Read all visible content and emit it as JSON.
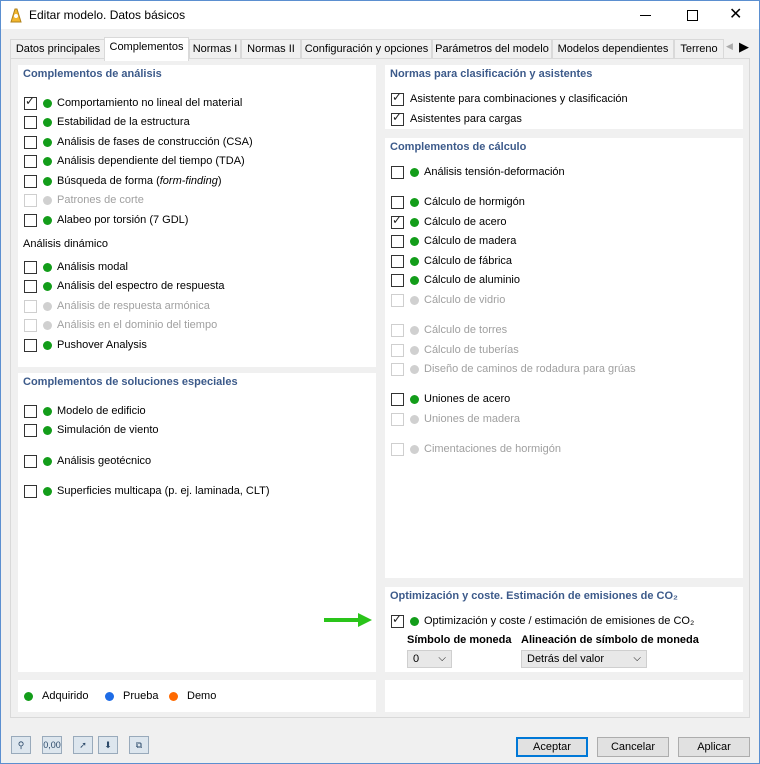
{
  "window": {
    "title": "Editar modelo. Datos básicos"
  },
  "tabs": [
    {
      "label": "Datos principales",
      "active": false
    },
    {
      "label": "Complementos",
      "active": true
    },
    {
      "label": "Normas I",
      "active": false
    },
    {
      "label": "Normas II",
      "active": false
    },
    {
      "label": "Configuración y opciones",
      "active": false
    },
    {
      "label": "Parámetros del modelo",
      "active": false
    },
    {
      "label": "Modelos dependientes",
      "active": false
    },
    {
      "label": "Terreno",
      "active": false
    }
  ],
  "analysis": {
    "title": "Complementos de análisis",
    "items": [
      {
        "label": "Comportamiento no lineal del material",
        "checked": true,
        "enabled": true
      },
      {
        "label": "Estabilidad de la estructura",
        "checked": false,
        "enabled": true
      },
      {
        "label": "Análisis de fases de construcción (CSA)",
        "checked": false,
        "enabled": true
      },
      {
        "label": "Análisis dependiente del tiempo (TDA)",
        "checked": false,
        "enabled": true
      },
      {
        "label_pre": "Búsqueda de forma (",
        "label_em": "form-finding",
        "label_post": ")",
        "checked": false,
        "enabled": true
      },
      {
        "label": "Patrones de corte",
        "checked": false,
        "enabled": false
      },
      {
        "label": "Alabeo por torsión (7 GDL)",
        "checked": false,
        "enabled": true
      }
    ],
    "dynamic_title": "Análisis dinámico",
    "dynamic_items": [
      {
        "label": "Análisis modal",
        "checked": false,
        "enabled": true
      },
      {
        "label": "Análisis del espectro de respuesta",
        "checked": false,
        "enabled": true
      },
      {
        "label": "Análisis de respuesta armónica",
        "checked": false,
        "enabled": false
      },
      {
        "label": "Análisis en el dominio del tiempo",
        "checked": false,
        "enabled": false
      },
      {
        "label": "Pushover Analysis",
        "checked": false,
        "enabled": true
      }
    ]
  },
  "special": {
    "title": "Complementos de soluciones especiales",
    "items": [
      {
        "label": "Modelo de edificio",
        "checked": false,
        "enabled": true
      },
      {
        "label": "Simulación de viento",
        "checked": false,
        "enabled": true
      },
      {
        "label": "Análisis geotécnico",
        "checked": false,
        "enabled": true
      },
      {
        "label": "Superficies multicapa (p. ej. laminada, CLT)",
        "checked": false,
        "enabled": true
      }
    ]
  },
  "norms": {
    "title": "Normas para clasificación y asistentes",
    "items": [
      {
        "label": "Asistente para combinaciones y clasificación",
        "checked": true
      },
      {
        "label": "Asistentes para cargas",
        "checked": true
      }
    ]
  },
  "calc": {
    "title": "Complementos de cálculo",
    "items": [
      {
        "label": "Análisis tensión-deformación",
        "checked": false,
        "enabled": true
      },
      {
        "label": "Cálculo de hormigón",
        "checked": false,
        "enabled": true
      },
      {
        "label": "Cálculo de acero",
        "checked": true,
        "enabled": true
      },
      {
        "label": "Cálculo de madera",
        "checked": false,
        "enabled": true
      },
      {
        "label": "Cálculo de fábrica",
        "checked": false,
        "enabled": true
      },
      {
        "label": "Cálculo de aluminio",
        "checked": false,
        "enabled": true
      },
      {
        "label": "Cálculo de vidrio",
        "checked": false,
        "enabled": false
      },
      {
        "label": "Cálculo de torres",
        "checked": false,
        "enabled": false
      },
      {
        "label": "Cálculo de tuberías",
        "checked": false,
        "enabled": false
      },
      {
        "label": "Diseño de caminos de rodadura para grúas",
        "checked": false,
        "enabled": false
      },
      {
        "label": "Uniones de acero",
        "checked": false,
        "enabled": true
      },
      {
        "label": "Uniones de madera",
        "checked": false,
        "enabled": false
      },
      {
        "label": "Cimentaciones de hormigón",
        "checked": false,
        "enabled": false
      }
    ]
  },
  "opt": {
    "title": "Optimización y coste. Estimación de emisiones de CO₂",
    "item_label": "Optimización y coste / estimación de emisiones de CO₂",
    "item_checked": true,
    "currency_label": "Símbolo de moneda",
    "currency_value": "0",
    "align_label": "Alineación de símbolo de moneda",
    "align_value": "Detrás del valor"
  },
  "legend": [
    {
      "label": "Adquirido",
      "color": "#139d1a"
    },
    {
      "label": "Prueba",
      "color": "#1e6ce6"
    },
    {
      "label": "Demo",
      "color": "#ff6a00"
    }
  ],
  "bottom_icons": [
    {
      "name": "search-icon",
      "glyph": "⚲"
    },
    {
      "name": "decimal-format-icon",
      "glyph": "0,00"
    },
    {
      "name": "model-info-icon",
      "glyph": "➚"
    },
    {
      "name": "import-icon",
      "glyph": "⬇"
    },
    {
      "name": "copy-icon",
      "glyph": "⧉"
    }
  ],
  "buttons": {
    "accept": "Aceptar",
    "cancel": "Cancelar",
    "apply": "Aplicar"
  }
}
